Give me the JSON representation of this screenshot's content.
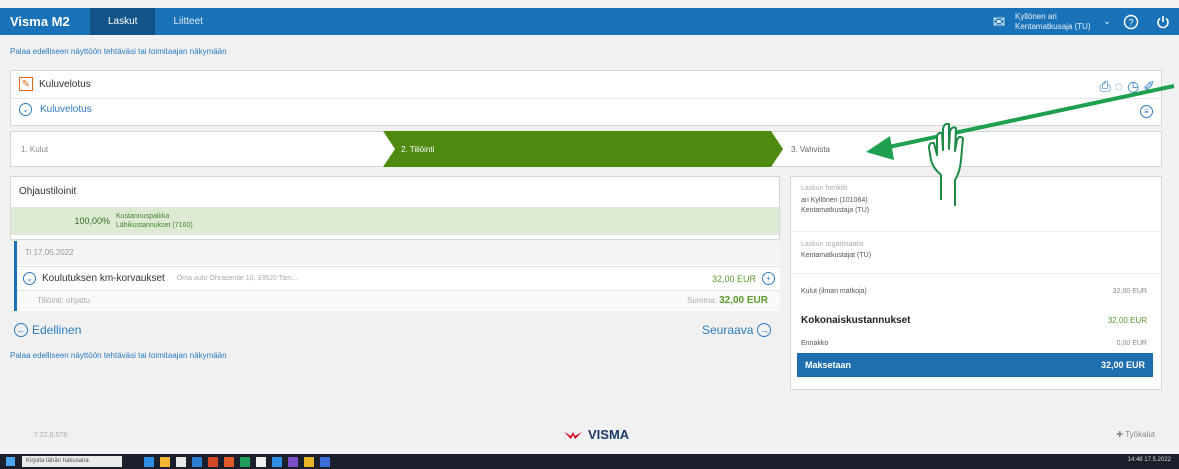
{
  "app": {
    "brand": "Visma M2",
    "tabs": [
      {
        "label": "Laskut",
        "active": true
      },
      {
        "label": "Liitteet",
        "active": false
      }
    ],
    "user": {
      "line1": "Kyllönen ari",
      "line2": "Kentamatkusaja (TU)"
    }
  },
  "backlink": "Palaa edelliseen näyttöön tehtäväsi tai toimitaajan näkymään",
  "doc": {
    "title": "Kuluvelotus",
    "subtitle": "Kuluvelotus"
  },
  "steps": [
    {
      "label": "1. Kulut",
      "state": "done"
    },
    {
      "label": "2. Tiliöinti",
      "state": "active"
    },
    {
      "label": "3. Vahvista",
      "state": "next"
    }
  ],
  "allocation": {
    "heading": "Ohjaustiloinit",
    "percent": "100,00%",
    "line1": "Kustannuspaikka",
    "line2": "Lähikustannukset (7160)"
  },
  "item": {
    "date": "Ti 17.05.2022",
    "name": "Koulutuksen km-korvaukset",
    "address": "Oma auto Ohrasentie 10, 33520 Tam...",
    "amount": "32,00 EUR",
    "status": "Tiliöinti: ohjattu",
    "sum_label": "Summa:",
    "sum_value": "32,00 EUR"
  },
  "nav": {
    "prev": "Edellinen",
    "next": "Seuraava"
  },
  "summary": {
    "bill_person_label": "Laskun henkilö",
    "bill_person_value": "ari Kyllönen (101084)",
    "bill_person_role": "Kentamatkustaja (TU)",
    "org_label": "Laskun organisaatio",
    "org_value": "Kentamatkustajat (TU)",
    "rows": [
      {
        "label": "Kulut (ilman matkoja)",
        "value": "32,00 EUR",
        "style": "normal"
      },
      {
        "label": "Kokonaiskustannukset",
        "value": "32,00 EUR",
        "style": "bold"
      },
      {
        "label": "Ennakko",
        "value": "0,00 EUR",
        "style": "normal"
      }
    ],
    "total_label": "Maksetaan",
    "total_value": "32,00 EUR"
  },
  "footer": {
    "version": "7.22.0.578",
    "logo": "VISMA",
    "tools": "Työkalut"
  },
  "taskbar": {
    "search": "Kirjoita tähän hakusana",
    "clock": "14:48 17.5.2022"
  },
  "colors": {
    "topbar": "#1a73b8",
    "step_active": "#4f8a10",
    "green_bg": "#dfead4",
    "total_bg": "#1f6fb0",
    "annotation": "#1fa050"
  }
}
